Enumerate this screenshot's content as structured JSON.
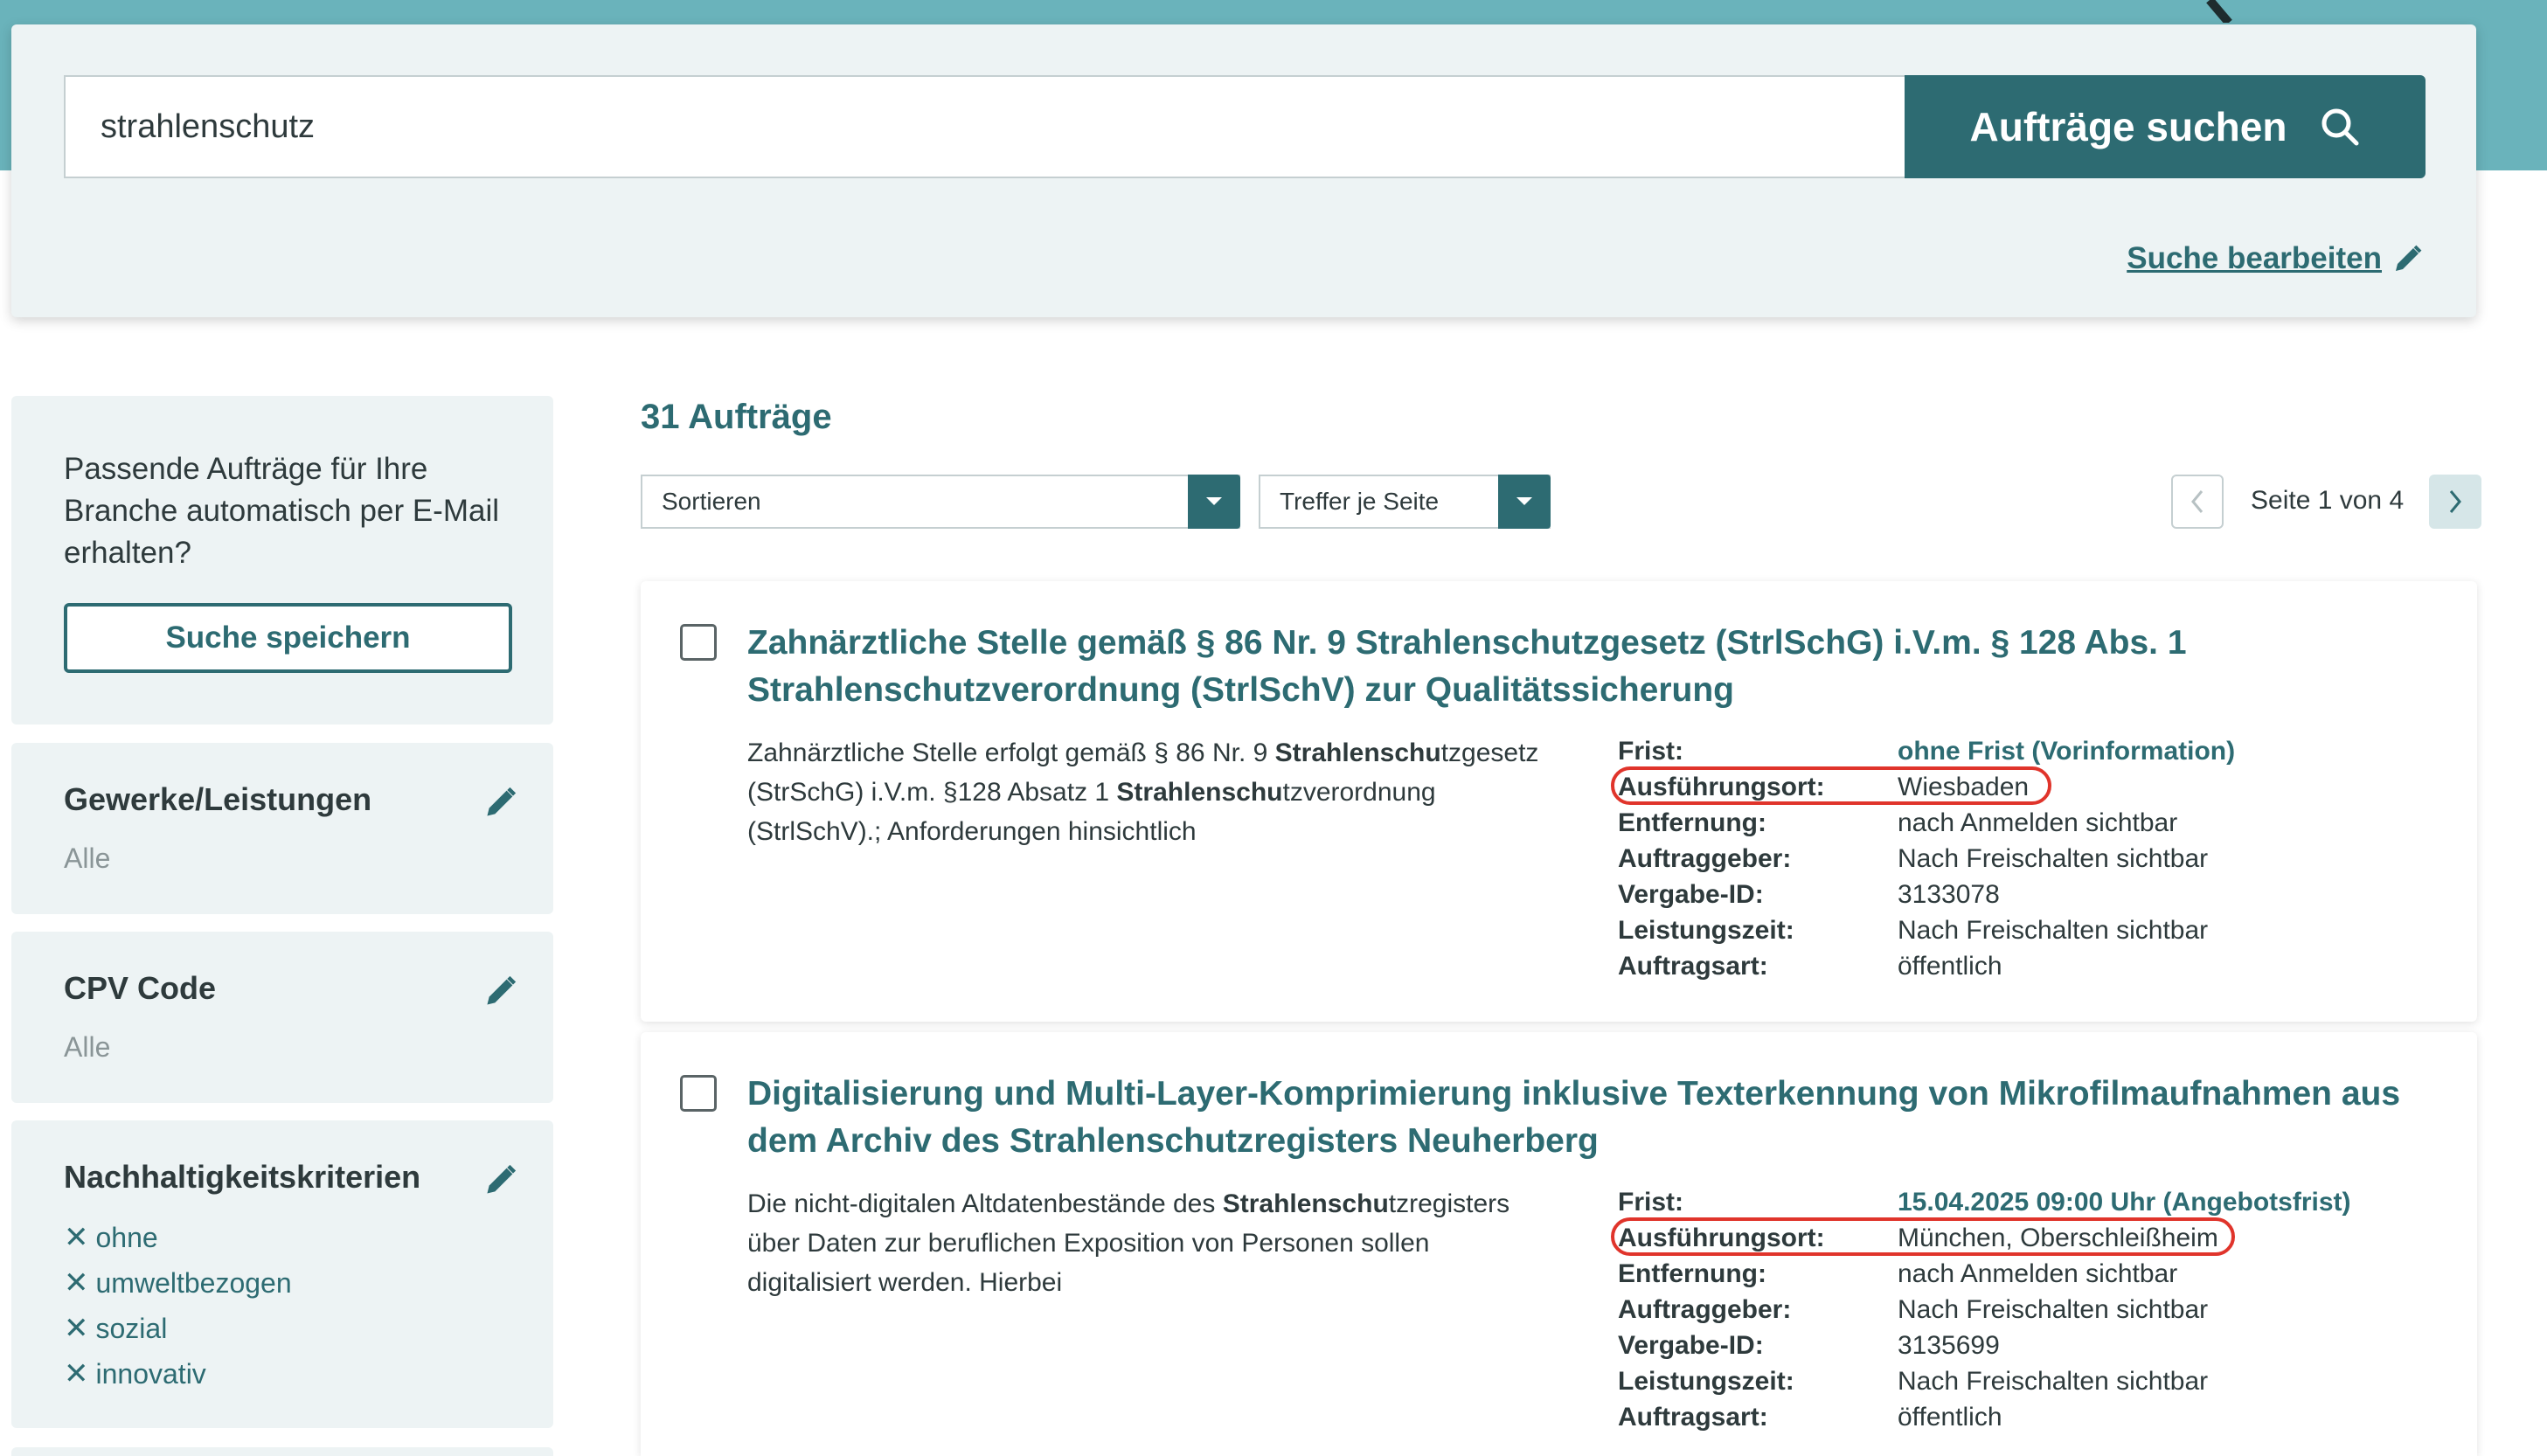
{
  "search": {
    "query": "strahlenschutz",
    "button_label": "Aufträge suchen",
    "edit_label": "Suche bearbeiten"
  },
  "sidebar": {
    "promo": {
      "text": "Passende Aufträge für Ihre Branche automatisch per E-Mail erhalten?",
      "button_label": "Suche speichern"
    },
    "filters": [
      {
        "title": "Gewerke/Leistungen",
        "value": "Alle"
      },
      {
        "title": "CPV Code",
        "value": "Alle"
      },
      {
        "title": "Nachhaltigkeitskriterien",
        "chips": [
          "ohne",
          "umweltbezogen",
          "sozial",
          "innovativ"
        ]
      }
    ]
  },
  "results": {
    "count_label": "31 Aufträge",
    "sort_label": "Sortieren",
    "per_page_label": "Treffer je Seite",
    "page_label": "Seite 1 von 4",
    "items": [
      {
        "title": "Zahnärztliche Stelle gemäß § 86 Nr. 9 Strahlenschutzgesetz (StrlSchG) i.V.m. § 128 Abs. 1 Strahlenschutzverordnung (StrlSchV) zur Qualitätssicherung",
        "desc": {
          "p1": "Zahnärztliche Stelle erfolgt gemäß § 86 Nr. 9 ",
          "b1": "Strahlenschu",
          "p2": "tzgesetz (StrSchG) i.V.m. §128 Absatz 1 ",
          "b2": "Strahlenschu",
          "p3": "tzverordnung (StrlSchV).; Anforderungen hinsichtlich"
        },
        "meta": {
          "frist_label": "Frist:",
          "frist": "ohne Frist (Vorinformation)",
          "ort_label": "Ausführungsort:",
          "ort": "Wiesbaden",
          "entfernung_label": "Entfernung:",
          "entfernung": "nach Anmelden sichtbar",
          "auftraggeber_label": "Auftraggeber:",
          "auftraggeber": "Nach Freischalten sichtbar",
          "vergabe_label": "Vergabe-ID:",
          "vergabe": "3133078",
          "leistung_label": "Leistungszeit:",
          "leistung": "Nach Freischalten sichtbar",
          "art_label": "Auftragsart:",
          "art": "öffentlich"
        }
      },
      {
        "title": "Digitalisierung und Multi-Layer-Komprimierung inklusive Texterkennung von Mikrofilmaufnahmen aus dem Archiv des Strahlenschutzregisters Neuherberg",
        "desc": {
          "p1": "Die nicht-digitalen Altdatenbestände des ",
          "b1": "Strahlenschu",
          "p2": "tzregisters über Daten zur beruflichen Exposition von Personen sollen digitalisiert werden. Hierbei"
        },
        "meta": {
          "frist_label": "Frist:",
          "frist": "15.04.2025 09:00 Uhr (Angebotsfrist)",
          "ort_label": "Ausführungsort:",
          "ort": "München, Oberschleißheim",
          "entfernung_label": "Entfernung:",
          "entfernung": "nach Anmelden sichtbar",
          "auftraggeber_label": "Auftraggeber:",
          "auftraggeber": "Nach Freischalten sichtbar",
          "vergabe_label": "Vergabe-ID:",
          "vergabe": "3135699",
          "leistung_label": "Leistungszeit:",
          "leistung": "Nach Freischalten sichtbar",
          "art_label": "Auftragsart:",
          "art": "öffentlich"
        }
      }
    ]
  },
  "colors": {
    "brand_teal": "#2d6b72",
    "header_teal": "#6ab3bb",
    "panel_bg": "#edf3f4",
    "highlight_red": "#e0342b"
  },
  "icons": {
    "search": "search-icon",
    "edit": "pencil-icon",
    "remove": "close-icon",
    "dropdown": "chevron-down-icon",
    "prev": "chevron-left-icon",
    "next": "chevron-right-icon"
  }
}
